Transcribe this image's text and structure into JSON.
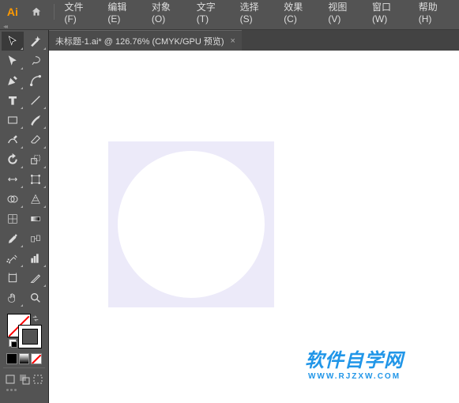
{
  "app": {
    "logo": "Ai"
  },
  "menu": {
    "file": "文件(F)",
    "edit": "编辑(E)",
    "object": "对象(O)",
    "type": "文字(T)",
    "select": "选择(S)",
    "effect": "效果(C)",
    "view": "视图(V)",
    "window": "窗口(W)",
    "help": "帮助(H)"
  },
  "tab": {
    "title": "未标题-1.ai* @ 126.76% (CMYK/GPU 预览)",
    "close": "×"
  },
  "panel_handle": "◂◂",
  "tools": {
    "selection": "选择工具",
    "magic_wand": "魔棒",
    "direct_selection": "直接选择",
    "lasso": "套索",
    "pen": "钢笔",
    "curvature": "曲率",
    "type": "文字",
    "line": "直线段",
    "rectangle": "矩形",
    "brush": "画笔",
    "shaper": "Shaper",
    "eraser": "橡皮擦",
    "rotate": "旋转",
    "scale": "比例缩放",
    "width": "宽度",
    "free_transform": "自由变换",
    "shape_builder": "形状生成器",
    "perspective": "透视网格",
    "mesh": "网格",
    "gradient": "渐变",
    "eyedropper": "吸管",
    "blend": "混合",
    "symbol_sprayer": "符号喷枪",
    "graph": "柱形图",
    "artboard": "画板",
    "slice": "切片",
    "hand": "抓手",
    "zoom": "缩放"
  },
  "colors": {
    "fill": "#ffffff",
    "stroke": "none",
    "accent": "#ff9a00"
  },
  "watermark": {
    "cn": "软件自学网",
    "en": "WWW.RJZXW.COM"
  }
}
